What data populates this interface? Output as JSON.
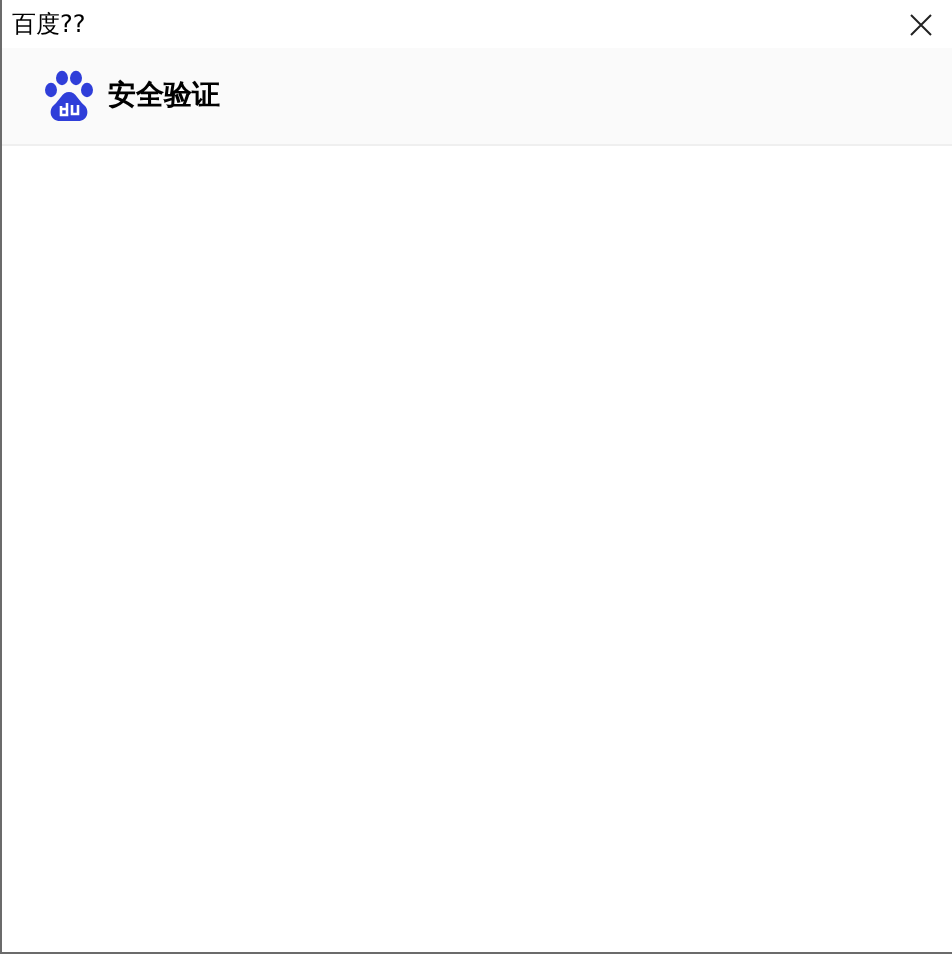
{
  "window": {
    "title": "百度??"
  },
  "header": {
    "title": "安全验证"
  }
}
